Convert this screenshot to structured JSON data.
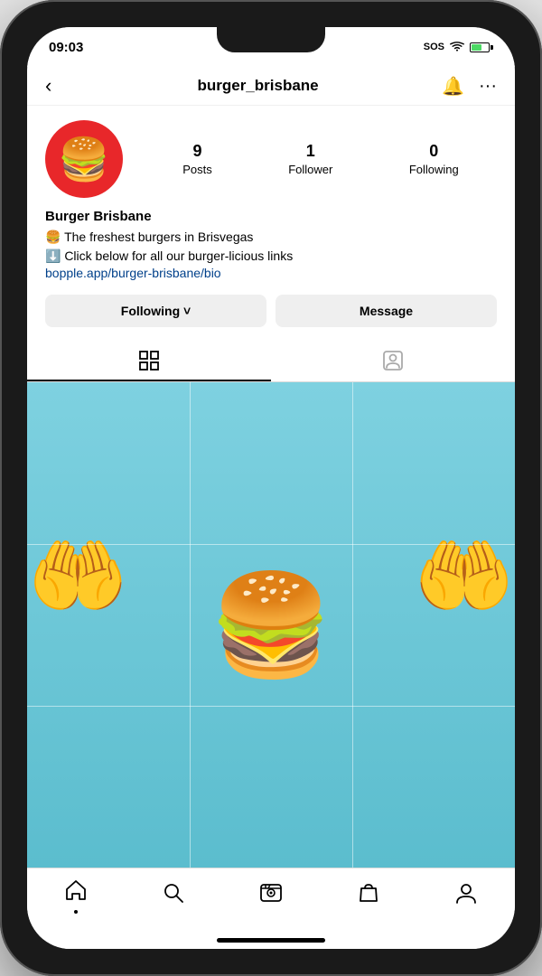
{
  "statusBar": {
    "time": "09:03",
    "carrier": "SOS",
    "battery": "60%"
  },
  "nav": {
    "username": "burger_brisbane",
    "backLabel": "‹",
    "bellIcon": "🔔",
    "moreIcon": "···"
  },
  "profile": {
    "avatarEmoji": "🍔",
    "stats": {
      "posts": {
        "count": "9",
        "label": "Posts"
      },
      "followers": {
        "count": "1",
        "label": "Follower"
      },
      "following": {
        "count": "0",
        "label": "Following"
      }
    },
    "name": "Burger Brisbane",
    "bio": [
      "🍔 The freshest burgers in Brisvegas",
      "⬇️ Click below for all our burger-licious links"
    ],
    "link": "bopple.app/burger-brisbane/bio"
  },
  "actions": {
    "followingLabel": "Following ˅",
    "messageLabel": "Message"
  },
  "tabs": {
    "gridLabel": "⊞",
    "tagLabel": "👤"
  },
  "bottomNav": {
    "items": [
      {
        "icon": "🏠",
        "name": "home",
        "hasIndicator": true
      },
      {
        "icon": "🔍",
        "name": "search",
        "hasIndicator": false
      },
      {
        "icon": "🎬",
        "name": "reels",
        "hasIndicator": false
      },
      {
        "icon": "🛍",
        "name": "shop",
        "hasIndicator": false
      },
      {
        "icon": "👤",
        "name": "profile",
        "hasIndicator": false
      }
    ]
  }
}
